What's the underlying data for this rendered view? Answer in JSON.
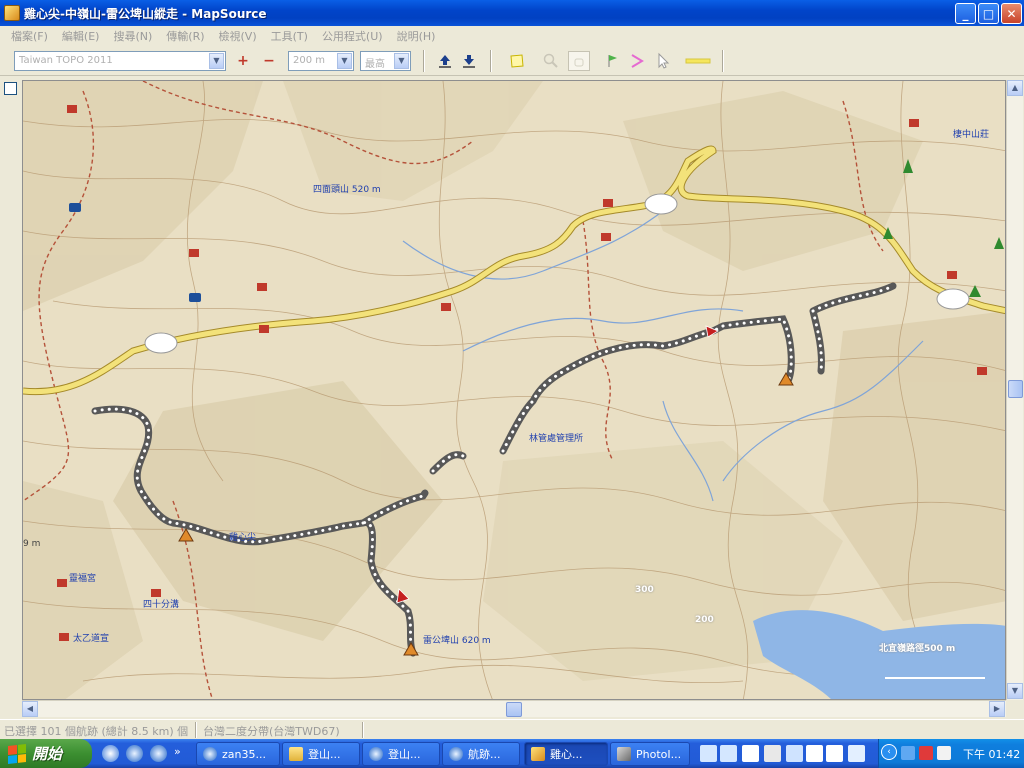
{
  "window": {
    "title": "雞心尖-中嶺山-雷公埤山縱走 - MapSource",
    "minimize": "_",
    "maximize": "□",
    "close": "✕"
  },
  "menu": [
    "檔案(F)",
    "編輯(E)",
    "搜尋(N)",
    "傳輸(R)",
    "檢視(V)",
    "工具(T)",
    "公用程式(U)",
    "說明(H)"
  ],
  "toolbar": {
    "product_combo": "Taiwan TOPO 2011",
    "zoom_combo": "200 m",
    "detail_combo": "最高"
  },
  "map": {
    "labels": {
      "sisiman": "四面頭山 520 m",
      "jixinjian": "雞心尖",
      "forest_station": "林管處管理所",
      "sishifen": "四十分溝",
      "taiyi": "太乙道宣",
      "lingfu": "靈福宮",
      "leigong": "雷公埤山 620 m",
      "chimu": "棲中山莊",
      "elev_300": "300",
      "elev_200": "200",
      "elev_9m": "9 m",
      "scale": "北宜嶺路徑500 m"
    },
    "colors": {
      "terrain": "#e9dfc4",
      "road": "#f3e27a",
      "track": "#555555",
      "water": "#8fb6e6"
    }
  },
  "statusbar": {
    "selection": "已選擇 101 個航跡 (總計 8.5 km) 個",
    "datum": "台灣二度分帶(台灣TWD67)"
  },
  "taskbar": {
    "start": "開始",
    "tasks": [
      {
        "label": "zan35...",
        "icon": "ie-icon"
      },
      {
        "label": "登山...",
        "icon": "folder-icon"
      },
      {
        "label": "登山...",
        "icon": "ie-icon"
      },
      {
        "label": "航跡...",
        "icon": "ie-icon"
      },
      {
        "label": "雞心...",
        "icon": "mapsource-icon"
      },
      {
        "label": "PhotoI...",
        "icon": "photo-icon"
      }
    ],
    "clock": "下午 01:42"
  }
}
